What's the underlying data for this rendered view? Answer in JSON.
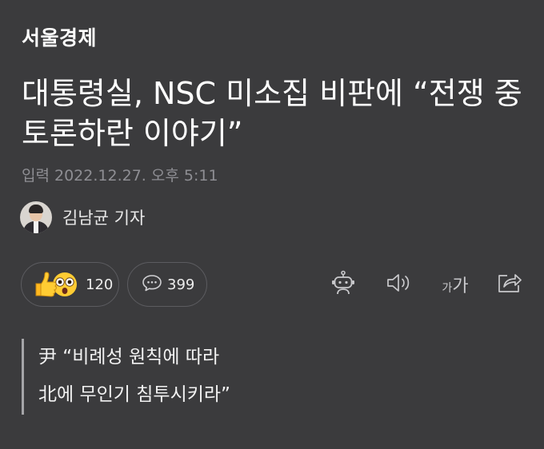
{
  "article": {
    "publisher": "서울경제",
    "headline": "대통령실, NSC 미소집 비판에 “전쟁 중 토론하란 이야기”",
    "dateline": "입력 2022.12.27. 오후 5:11",
    "author": "김남균 기자",
    "subheadline": [
      "尹 “비례성 원칙에 따라",
      "北에 무인기 침투시키라”"
    ]
  },
  "toolbar": {
    "reaction_count": "120",
    "comment_count": "399",
    "font_size_label_small": "가",
    "font_size_label_big": "가",
    "icons": {
      "reaction": "thumbs-up-and-surprised-emoji",
      "comment": "speech-bubble-icon",
      "summary_bot": "robot-icon",
      "read_aloud": "speaker-icon",
      "share": "share-icon"
    }
  },
  "colors": {
    "background": "#3b3b3d",
    "text_primary": "#ffffff",
    "text_secondary": "#8e8e93",
    "border": "#5c5c60",
    "emoji_yellow": "#ffcc33"
  }
}
